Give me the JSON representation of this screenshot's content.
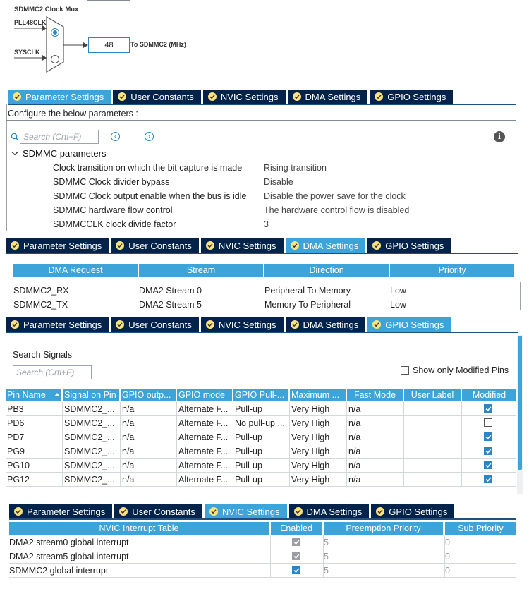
{
  "mux": {
    "title": "SDMMC2 Clock Mux",
    "input1": "PLL48CLK",
    "input2": "SYSCLK",
    "value": "48",
    "output_label": "To SDMMC2 (MHz)"
  },
  "tabs": {
    "parameter": "Parameter Settings",
    "user_constants": "User Constants",
    "nvic": "NVIC Settings",
    "dma": "DMA Settings",
    "gpio": "GPIO Settings"
  },
  "params": {
    "configure_label": "Configure the below parameters :",
    "search_placeholder": "Search (Crtl+F)",
    "group": "SDMMC parameters",
    "rows": [
      {
        "name": "Clock transition on which the bit capture is made",
        "value": "Rising transition"
      },
      {
        "name": "SDMMC Clock divider bypass",
        "value": "Disable"
      },
      {
        "name": "SDMMC Clock output enable when the bus is idle",
        "value": "Disable the power save for the clock"
      },
      {
        "name": "SDMMC hardware flow control",
        "value": "The hardware control flow is disabled"
      },
      {
        "name": "SDMMCCLK clock divide factor",
        "value": "3"
      }
    ]
  },
  "dma": {
    "headers": [
      "DMA Request",
      "Stream",
      "Direction",
      "Priority"
    ],
    "rows": [
      [
        "SDMMC2_RX",
        "DMA2 Stream 0",
        "Peripheral To Memory",
        "Low"
      ],
      [
        "SDMMC2_TX",
        "DMA2 Stream 5",
        "Memory To Peripheral",
        "Low"
      ]
    ]
  },
  "gpio": {
    "search_label": "Search Signals",
    "search_placeholder": "Search (Crtl+F)",
    "show_modified": "Show only Modified Pins",
    "headers": [
      "Pin Name",
      "Signal on Pin",
      "GPIO outp...",
      "GPIO mode",
      "GPIO Pull-...",
      "Maximum ...",
      "Fast Mode",
      "User Label",
      "Modified"
    ],
    "rows": [
      {
        "pin": "PB3",
        "signal": "SDMMC2_...",
        "output": "n/a",
        "mode": "Alternate F...",
        "pull": "Pull-up",
        "speed": "Very High",
        "fast": "n/a",
        "label": "",
        "modified": true
      },
      {
        "pin": "PD6",
        "signal": "SDMMC2_...",
        "output": "n/a",
        "mode": "Alternate F...",
        "pull": "No pull-up ...",
        "speed": "Very High",
        "fast": "n/a",
        "label": "",
        "modified": false
      },
      {
        "pin": "PD7",
        "signal": "SDMMC2_...",
        "output": "n/a",
        "mode": "Alternate F...",
        "pull": "Pull-up",
        "speed": "Very High",
        "fast": "n/a",
        "label": "",
        "modified": true
      },
      {
        "pin": "PG9",
        "signal": "SDMMC2_...",
        "output": "n/a",
        "mode": "Alternate F...",
        "pull": "Pull-up",
        "speed": "Very High",
        "fast": "n/a",
        "label": "",
        "modified": true
      },
      {
        "pin": "PG10",
        "signal": "SDMMC2_...",
        "output": "n/a",
        "mode": "Alternate F...",
        "pull": "Pull-up",
        "speed": "Very High",
        "fast": "n/a",
        "label": "",
        "modified": true
      },
      {
        "pin": "PG12",
        "signal": "SDMMC2_...",
        "output": "n/a",
        "mode": "Alternate F...",
        "pull": "Pull-up",
        "speed": "Very High",
        "fast": "n/a",
        "label": "",
        "modified": true
      }
    ]
  },
  "nvic": {
    "headers": [
      "NVIC Interrupt Table",
      "Enabled",
      "Preemption Priority",
      "Sub Priority"
    ],
    "rows": [
      {
        "name": "DMA2 stream0 global interrupt",
        "enabled": true,
        "locked": true,
        "preemption": "5",
        "sub": "0"
      },
      {
        "name": "DMA2 stream5 global interrupt",
        "enabled": true,
        "locked": true,
        "preemption": "5",
        "sub": "0"
      },
      {
        "name": "SDMMC2 global interrupt",
        "enabled": true,
        "locked": false,
        "preemption": "5",
        "sub": "0"
      }
    ]
  },
  "colors": {
    "tab_dark": "#03234b",
    "tab_active": "#3ca4d8",
    "header_blue": "#3ca4d8",
    "check_yellow": "#ffe37a"
  }
}
